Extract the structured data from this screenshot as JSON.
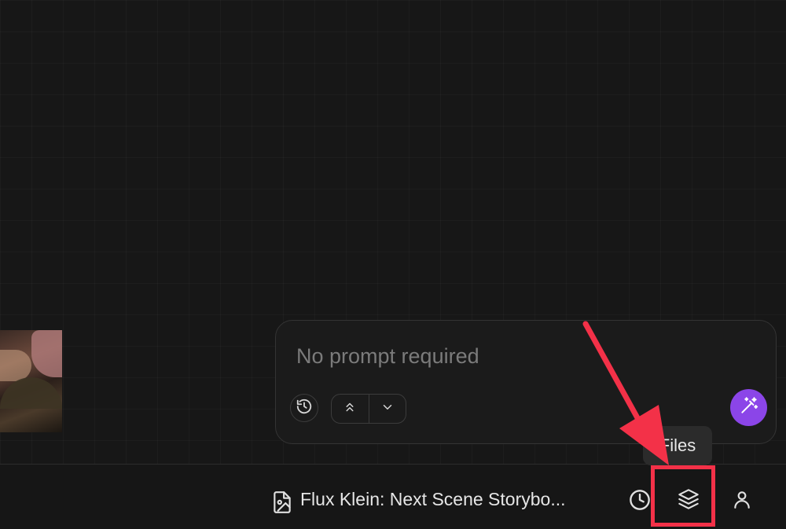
{
  "prompt": {
    "placeholder": "No prompt required"
  },
  "footer": {
    "file_title": "Flux Klein: Next Scene Storybo..."
  },
  "tooltip": {
    "text": "Files"
  },
  "icons": {
    "history": "history-icon",
    "collapse": "chevrons-up-icon",
    "expand": "chevron-down-icon",
    "magic": "magic-wand-icon",
    "file": "file-image-icon",
    "clock": "clock-icon",
    "files": "layers-icon",
    "user": "user-icon"
  },
  "colors": {
    "accent": "#8b45e8",
    "annotation": "#f33148"
  }
}
